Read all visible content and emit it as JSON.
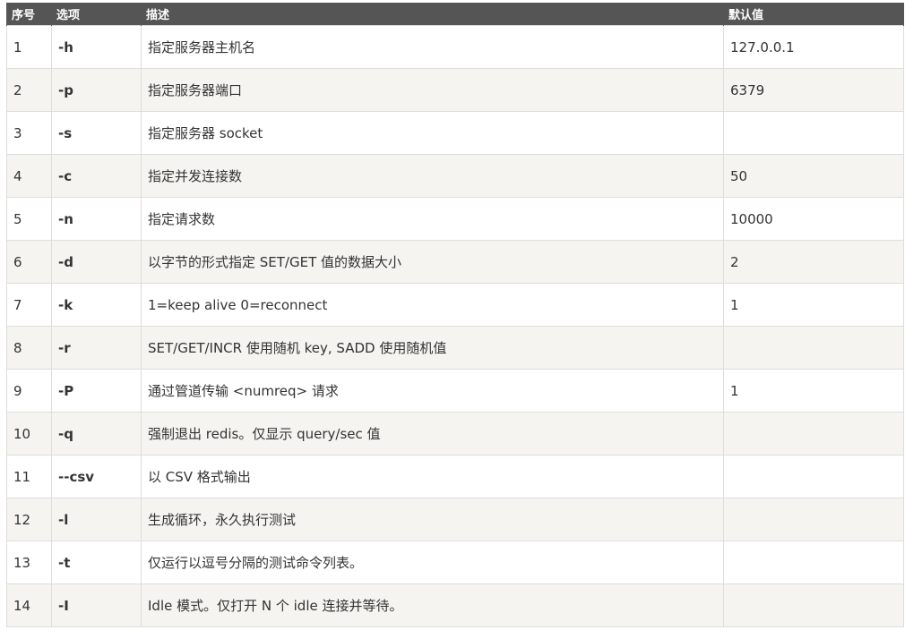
{
  "table": {
    "headers": [
      "序号",
      "选项",
      "描述",
      "默认值"
    ],
    "rows": [
      {
        "index": "1",
        "option": "-h",
        "description": "指定服务器主机名",
        "default": "127.0.0.1"
      },
      {
        "index": "2",
        "option": "-p",
        "description": "指定服务器端口",
        "default": "6379"
      },
      {
        "index": "3",
        "option": "-s",
        "description": "指定服务器 socket",
        "default": ""
      },
      {
        "index": "4",
        "option": "-c",
        "description": "指定并发连接数",
        "default": "50"
      },
      {
        "index": "5",
        "option": "-n",
        "description": "指定请求数",
        "default": "10000"
      },
      {
        "index": "6",
        "option": "-d",
        "description": "以字节的形式指定 SET/GET 值的数据大小",
        "default": "2"
      },
      {
        "index": "7",
        "option": "-k",
        "description": "1=keep alive 0=reconnect",
        "default": "1"
      },
      {
        "index": "8",
        "option": "-r",
        "description": "SET/GET/INCR 使用随机 key, SADD 使用随机值",
        "default": ""
      },
      {
        "index": "9",
        "option": "-P",
        "description": "通过管道传输 <numreq> 请求",
        "default": "1"
      },
      {
        "index": "10",
        "option": "-q",
        "description": "强制退出 redis。仅显示 query/sec 值",
        "default": ""
      },
      {
        "index": "11",
        "option": "--csv",
        "description": "以 CSV 格式输出",
        "default": ""
      },
      {
        "index": "12",
        "option": "-l",
        "description": "生成循环，永久执行测试",
        "default": ""
      },
      {
        "index": "13",
        "option": "-t",
        "description": "仅运行以逗号分隔的测试命令列表。",
        "default": ""
      },
      {
        "index": "14",
        "option": "-I",
        "description": "Idle 模式。仅打开 N 个 idle 连接并等待。",
        "default": ""
      }
    ]
  }
}
